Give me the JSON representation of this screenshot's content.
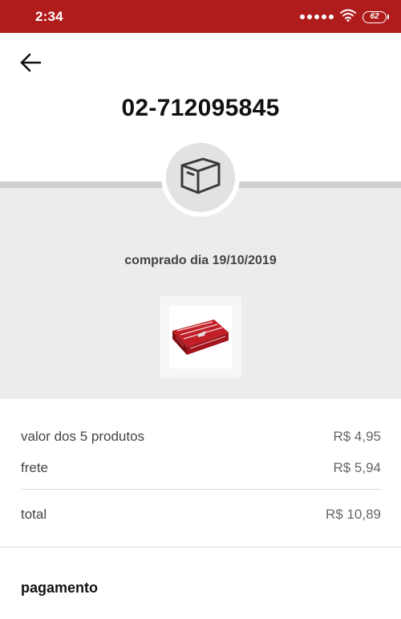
{
  "status_bar": {
    "time": "2:34",
    "battery": "62",
    "icons": [
      "signal-dots-icon",
      "wifi-icon",
      "battery-icon"
    ]
  },
  "header": {
    "back_icon": "arrow-left-icon",
    "order_number": "02-712095845"
  },
  "order": {
    "status_icon": "package-box-icon",
    "purchase_date_text": "comprado dia 19/10/2019",
    "product_image": "halls-candy-box"
  },
  "summary": {
    "products_label": "valor dos 5 produtos",
    "products_value": "R$ 4,95",
    "shipping_label": "frete",
    "shipping_value": "R$ 5,94",
    "total_label": "total",
    "total_value": "R$ 10,89"
  },
  "payment": {
    "title": "pagamento"
  },
  "colors": {
    "status_bar": "#b01c1c",
    "panel": "#ececec",
    "band": "#cfcfcf"
  }
}
